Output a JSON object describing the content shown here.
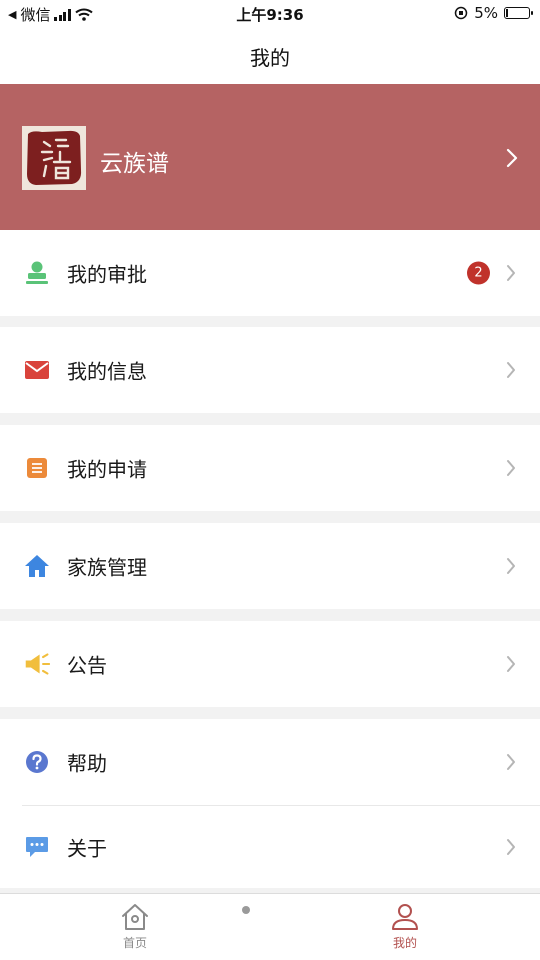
{
  "status_bar": {
    "carrier": "微信",
    "time": "上午9:36",
    "battery_text": "5%",
    "battery_level": 0.05
  },
  "nav": {
    "title": "我的"
  },
  "profile": {
    "name": "云族谱",
    "avatar_icon": "seal-avatar-icon",
    "background": "#b56363"
  },
  "menu": {
    "approval": {
      "label": "我的审批",
      "badge": "2",
      "icon": "stamp-icon",
      "color": "#5ac378"
    },
    "messages": {
      "label": "我的信息",
      "icon": "envelope-icon",
      "color": "#d9433b"
    },
    "applications": {
      "label": "我的申请",
      "icon": "document-icon",
      "color": "#ec8a3a"
    },
    "family": {
      "label": "家族管理",
      "icon": "house-icon",
      "color": "#3d86e0"
    },
    "notice": {
      "label": "公告",
      "icon": "megaphone-icon",
      "color": "#f1be3d"
    },
    "help": {
      "label": "帮助",
      "icon": "question-icon",
      "color": "#5a77cf"
    },
    "about": {
      "label": "关于",
      "icon": "chat-bubble-icon",
      "color": "#5b9be6"
    }
  },
  "tabs": {
    "home": {
      "label": "首页",
      "icon": "home-tab-icon"
    },
    "mine": {
      "label": "我的",
      "icon": "person-tab-icon",
      "active": true
    }
  }
}
